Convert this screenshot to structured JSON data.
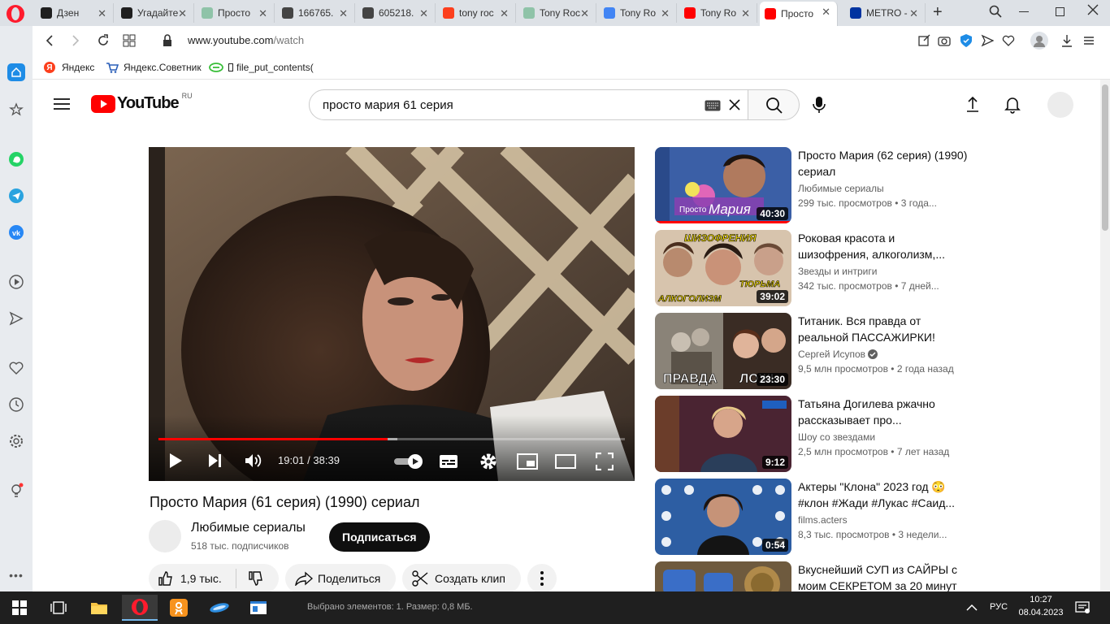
{
  "browser": {
    "tabs": [
      {
        "label": "Дзен",
        "fav_color": "#1f1f1f"
      },
      {
        "label": "Угадайте",
        "fav_color": "#1f1f1f"
      },
      {
        "label": "Просто",
        "fav_color": "#8fc3a8"
      },
      {
        "label": "166765.",
        "fav_color": "#444444"
      },
      {
        "label": "605218.",
        "fav_color": "#444444"
      },
      {
        "label": "tony roc",
        "fav_color": "#fc3f1d"
      },
      {
        "label": "Tony Roc",
        "fav_color": "#8fc3a8"
      },
      {
        "label": "Tony Ro",
        "fav_color": "#4285f4"
      },
      {
        "label": "Tony Ro",
        "fav_color": "#ff0000"
      },
      {
        "label": "Просто",
        "fav_color": "#ff0000"
      },
      {
        "label": "METRO -",
        "fav_color": "#0033a0"
      }
    ],
    "url_host": "www.youtube.com",
    "url_path": "/watch",
    "bookmarks": [
      "Яндекс",
      "Яндекс.Советник",
      "file_put_contents("
    ]
  },
  "youtube": {
    "logo_text": "YouTube",
    "region": "RU",
    "search_value": "просто мария 61 серия",
    "video": {
      "title": "Просто Мария (61 серия) (1990) сериал",
      "time_current": "19:01",
      "time_total": "38:39",
      "progress": 0.492
    },
    "channel": {
      "name": "Любимые сериалы",
      "subscribers": "518 тыс. подписчиков",
      "subscribe_label": "Подписаться"
    },
    "actions": {
      "likes": "1,9 тыс.",
      "share": "Поделиться",
      "clip": "Создать клип"
    },
    "recommendations": [
      {
        "title": "Просто Мария (62 серия) (1990) сериал",
        "channel": "Любимые сериалы",
        "views": "299 тыс. просмотров",
        "age": "3 года...",
        "duration": "40:30",
        "watched": 1.0,
        "thumb_text": "Просто Мария",
        "verified": false
      },
      {
        "title": "Роковая красота и шизофрения, алкоголизм,...",
        "channel": "Звезды и интриги",
        "views": "342 тыс. просмотров",
        "age": "7 дней...",
        "duration": "39:02",
        "watched": 0,
        "thumb_text": "ШИЗОФРЕНИЯ · ТЮРЬМА · АЛКОГОЛИЗМ",
        "verified": false
      },
      {
        "title": "Титаник. Вся правда от реальной ПАССАЖИРКИ!",
        "channel": "Сергей Исупов",
        "views": "9,5 млн просмотров",
        "age": "2 года назад",
        "duration": "23:30",
        "watched": 0,
        "thumb_text": "ПРАВДА · ЛОЖЬ",
        "verified": true
      },
      {
        "title": "Татьяна Догилева ржачно рассказывает про...",
        "channel": "Шоу со звездами",
        "views": "2,5 млн просмотров",
        "age": "7 лет назад",
        "duration": "9:12",
        "watched": 0,
        "thumb_text": "",
        "verified": false
      },
      {
        "title": "Актеры \"Клона\" 2023 год 😳 #клон #Жади #Лукас #Саид...",
        "channel": "films.acters",
        "views": "8,3 тыс. просмотров",
        "age": "3 недели...",
        "duration": "0:54",
        "watched": 0,
        "thumb_text": "",
        "verified": false
      },
      {
        "title": "Вкуснейший СУП из САЙРЫ с моим СЕКРЕТОМ за 20 минут",
        "channel": "",
        "views": "",
        "age": "",
        "duration": "",
        "watched": 0,
        "thumb_text": "",
        "verified": false
      }
    ]
  },
  "taskbar": {
    "status_text": "Выбрано элементов: 1. Размер: 0,8 МБ.",
    "lang": "РУС",
    "time": "10:27",
    "date": "08.04.2023"
  }
}
